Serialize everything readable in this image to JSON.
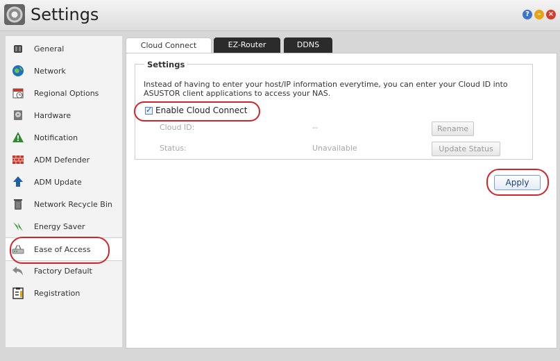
{
  "window": {
    "title": "Settings",
    "controls": {
      "help": "?",
      "minimize": "–",
      "close": "×"
    }
  },
  "sidebar": {
    "items": [
      {
        "label": "General",
        "icon": "general-icon"
      },
      {
        "label": "Network",
        "icon": "network-globe-icon"
      },
      {
        "label": "Regional Options",
        "icon": "calendar-clock-icon"
      },
      {
        "label": "Hardware",
        "icon": "hard-drive-icon"
      },
      {
        "label": "Notification",
        "icon": "warning-triangle-icon"
      },
      {
        "label": "ADM Defender",
        "icon": "firewall-brick-icon"
      },
      {
        "label": "ADM Update",
        "icon": "up-arrow-icon"
      },
      {
        "label": "Network Recycle Bin",
        "icon": "trash-can-icon"
      },
      {
        "label": "Energy Saver",
        "icon": "leaf-icon"
      },
      {
        "label": "Ease of Access",
        "icon": "router-icon"
      },
      {
        "label": "Factory Default",
        "icon": "undo-arrow-icon"
      },
      {
        "label": "Registration",
        "icon": "clipboard-icon"
      }
    ],
    "active_index": 9
  },
  "tabs": [
    {
      "label": "Cloud Connect",
      "active": true
    },
    {
      "label": "EZ-Router",
      "active": false
    },
    {
      "label": "DDNS",
      "active": false
    }
  ],
  "settings": {
    "legend": "Settings",
    "description": "Instead of having to enter your host/IP information everytime, you can enter your Cloud ID into ASUSTOR client applications to access your NAS.",
    "enable_label": "Enable Cloud Connect",
    "enable_checked": true,
    "cloud_id_label": "Cloud ID:",
    "cloud_id_value": "--",
    "rename_label": "Rename",
    "status_label": "Status:",
    "status_value": "Unavailable",
    "update_status_label": "Update Status"
  },
  "apply_label": "Apply",
  "colors": {
    "highlight": "#d2232a",
    "tab_dark": "#2b2b2b",
    "sidebar_bg": "#f3f3f3"
  }
}
